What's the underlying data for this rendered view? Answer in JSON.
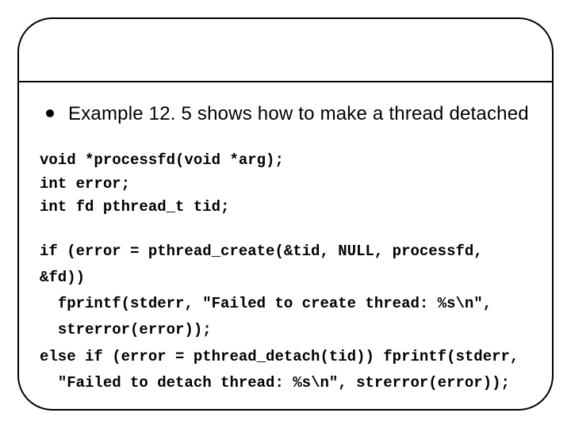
{
  "bullet": {
    "text": "Example 12. 5 shows how to make a thread detached"
  },
  "code": {
    "decl": "void *processfd(void *arg);\nint error;\nint fd pthread_t tid;",
    "body": "if (error = pthread_create(&tid, NULL, processfd, &fd))\n  fprintf(stderr, \"Failed to create thread: %s\\n\",\n  strerror(error));\nelse if (error = pthread_detach(tid)) fprintf(stderr,\n  \"Failed to detach thread: %s\\n\", strerror(error));"
  }
}
